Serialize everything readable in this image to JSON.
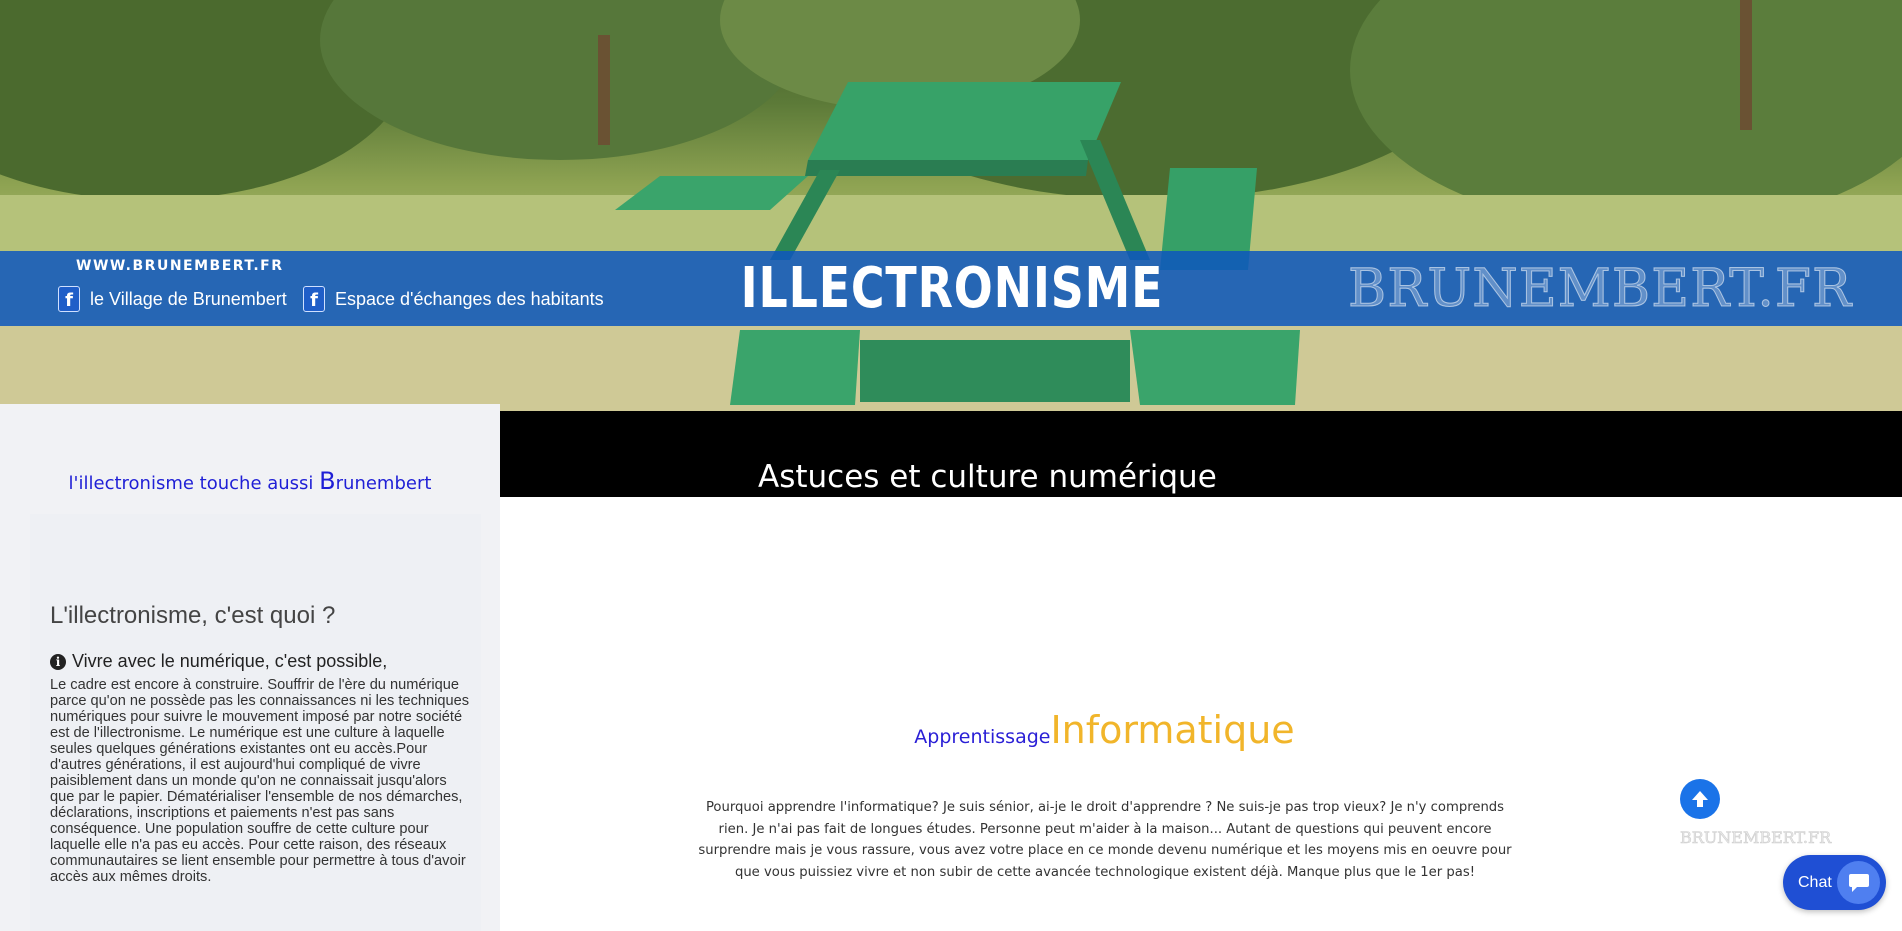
{
  "colors": {
    "banner_blue": "#0e56be",
    "section_bar": "#000000",
    "sidebar_bg": "#f1f2f5",
    "tagline_blue": "#1f1fd6",
    "heading_blue": "#2a1fd6",
    "heading_gold": "#f1b52a",
    "scroll_button": "#1a73e8",
    "chat_button": "#1f4fd4"
  },
  "header": {
    "site_url": "WWW.BRUNEMBERT.FR",
    "fb_links": [
      {
        "label": "le Village de Brunembert",
        "icon": "facebook-icon"
      },
      {
        "label": "Espace d'échanges des habitants",
        "icon": "facebook-icon"
      }
    ],
    "title": "ILLECTRONISME",
    "logo_text": "BRUNEMBERT.FR",
    "background": "picnic-table-photo"
  },
  "sidebar": {
    "tagline_prefix": "l'illectronisme touche aussi ",
    "tagline_initial": "B",
    "tagline_rest": "runembert",
    "card": {
      "heading": "L'illectronisme, c'est quoi ?",
      "sub_icon": "info-icon",
      "sub_heading": "Vivre avec le numérique, c'est possible,",
      "body": "Le cadre est encore à construire. Souffrir de l'ère du numérique parce qu'on ne possède pas les connaissances ni les techniques numériques pour suivre le mouvement imposé par notre société est de l'illectronisme. Le numérique est une culture à laquelle seules quelques générations existantes ont eu accès.Pour d'autres générations, il est aujourd'hui compliqué de vivre paisiblement dans un monde qu'on ne connaissait jusqu'alors que par le papier. Dématérialiser l'ensemble de nos démarches, déclarations, inscriptions et paiements n'est pas sans conséquence. Une population souffre de cette culture pour laquelle elle n'a pas eu accès. Pour cette raison, des réseaux communautaires se lient ensemble pour permettre à tous d'avoir accès aux mêmes droits."
    }
  },
  "main": {
    "section_title": "Astuces et culture numérique",
    "heading_small": "Apprentissage",
    "heading_large": "Informatique",
    "intro": "Pourquoi apprendre l'informatique? Je suis sénior, ai-je le droit d'apprendre ? Ne suis-je pas trop vieux? Je n'y comprends rien. Je n'ai pas fait de longues études. Personne peut m'aider à la maison... Autant de questions qui peuvent encore surprendre mais je vous rassure, vous avez votre place en ce monde devenu numérique et les moyens mis en oeuvre pour que vous puissiez vivre et non subir de cette avancée technologique existent déjà. Manque plus que le 1er pas!"
  },
  "floating": {
    "scroll_top_icon": "arrow-up-icon",
    "scroll_logo": "BRUNEMBERT.FR",
    "chat_label": "Chat",
    "chat_icon": "chat-bubble-icon"
  }
}
